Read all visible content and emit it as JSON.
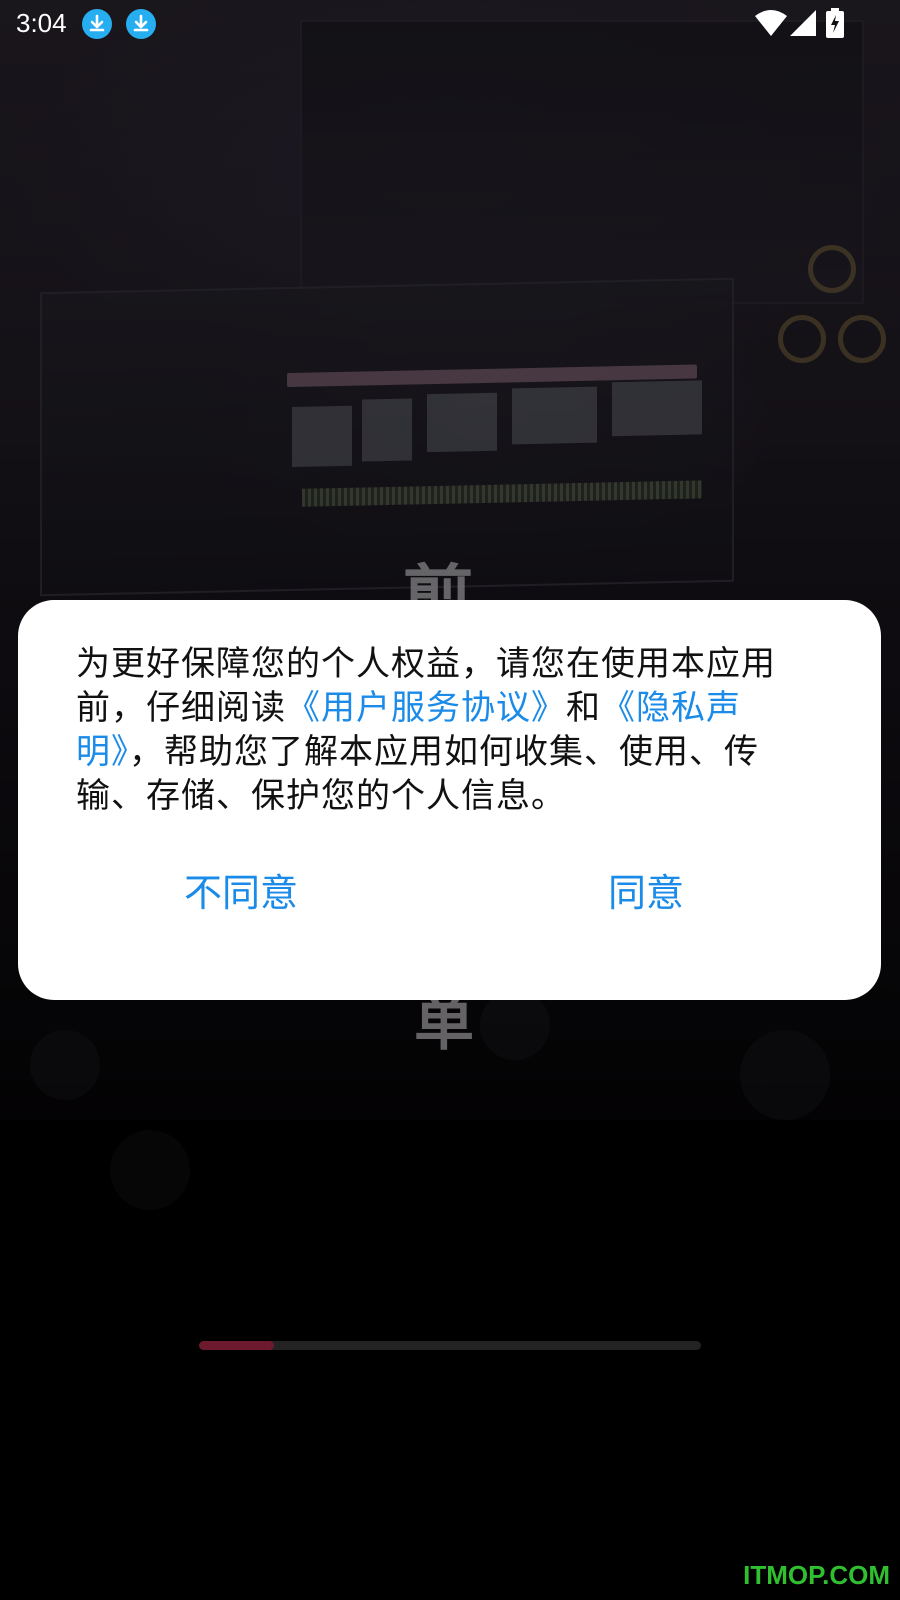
{
  "status_bar": {
    "time": "3:04",
    "icons": [
      "download-icon",
      "download-icon",
      "wifi-icon",
      "signal-icon",
      "battery-charging-icon"
    ]
  },
  "background": {
    "char_top": "剪",
    "char_bottom": "单"
  },
  "dialog": {
    "text_before": "为更好保障您的个人权益，请您在使用本应用前，仔细阅读",
    "user_agreement_link": "《用户服务协议》",
    "text_middle": "和",
    "privacy_link": "《隐私声明》",
    "text_after": "，帮助您了解本应用如何收集、使用、传输、存储、保护您的个人信息。",
    "disagree_label": "不同意",
    "agree_label": "同意",
    "link_color": "#1a8be8"
  },
  "loading": {
    "progress": 0.15,
    "fill_color": "#6e1a2e"
  },
  "watermark": "ITMOP.COM"
}
